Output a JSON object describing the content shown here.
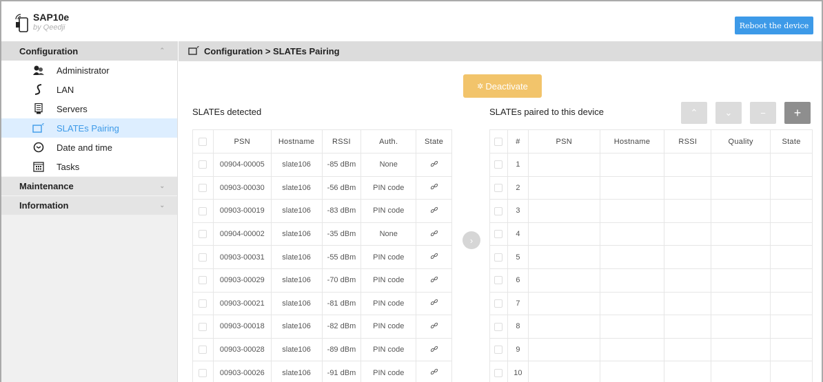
{
  "app": {
    "title": "SAP10e",
    "subtitle": "by Qeedji",
    "reboot_label": "Reboot the device"
  },
  "sidebar": {
    "sections": [
      {
        "label": "Configuration",
        "chevron": "⌃",
        "items": [
          {
            "label": "Administrator",
            "icon": "administrator-icon"
          },
          {
            "label": "LAN",
            "icon": "lan-icon"
          },
          {
            "label": "Servers",
            "icon": "server-icon"
          },
          {
            "label": "SLATEs Pairing",
            "icon": "slate-pairing-icon",
            "active": true
          },
          {
            "label": "Date and time",
            "icon": "clock-icon"
          },
          {
            "label": "Tasks",
            "icon": "calendar-icon"
          }
        ]
      },
      {
        "label": "Maintenance",
        "chevron": "⌄"
      },
      {
        "label": "Information",
        "chevron": "⌄"
      }
    ]
  },
  "breadcrumb": "Configuration > SLATEs Pairing",
  "deactivate_label": "Deactivate",
  "detected": {
    "title": "SLATEs detected",
    "columns": [
      "PSN",
      "Hostname",
      "RSSI",
      "Auth.",
      "State"
    ],
    "rows": [
      [
        "00904-00005",
        "slate106",
        "-85 dBm",
        "None"
      ],
      [
        "00903-00030",
        "slate106",
        "-56 dBm",
        "PIN code"
      ],
      [
        "00903-00019",
        "slate106",
        "-83 dBm",
        "PIN code"
      ],
      [
        "00904-00002",
        "slate106",
        "-35 dBm",
        "None"
      ],
      [
        "00903-00031",
        "slate106",
        "-55 dBm",
        "PIN code"
      ],
      [
        "00903-00029",
        "slate106",
        "-70 dBm",
        "PIN code"
      ],
      [
        "00903-00021",
        "slate106",
        "-81 dBm",
        "PIN code"
      ],
      [
        "00903-00018",
        "slate106",
        "-82 dBm",
        "PIN code"
      ],
      [
        "00903-00028",
        "slate106",
        "-89 dBm",
        "PIN code"
      ],
      [
        "00903-00026",
        "slate106",
        "-91 dBm",
        "PIN code"
      ]
    ]
  },
  "paired": {
    "title": "SLATEs paired to this device",
    "columns": [
      "#",
      "PSN",
      "Hostname",
      "RSSI",
      "Quality",
      "State"
    ],
    "rows": [
      "1",
      "2",
      "3",
      "4",
      "5",
      "6",
      "7",
      "8",
      "9",
      "10"
    ]
  },
  "toolbar": {
    "up": "⌃",
    "down": "⌄",
    "remove": "−",
    "add": "+"
  },
  "move_right": "›",
  "colors": {
    "accent": "#3d9ae8",
    "deactivate": "#f2c46b",
    "active_bg": "#ddeeff"
  }
}
